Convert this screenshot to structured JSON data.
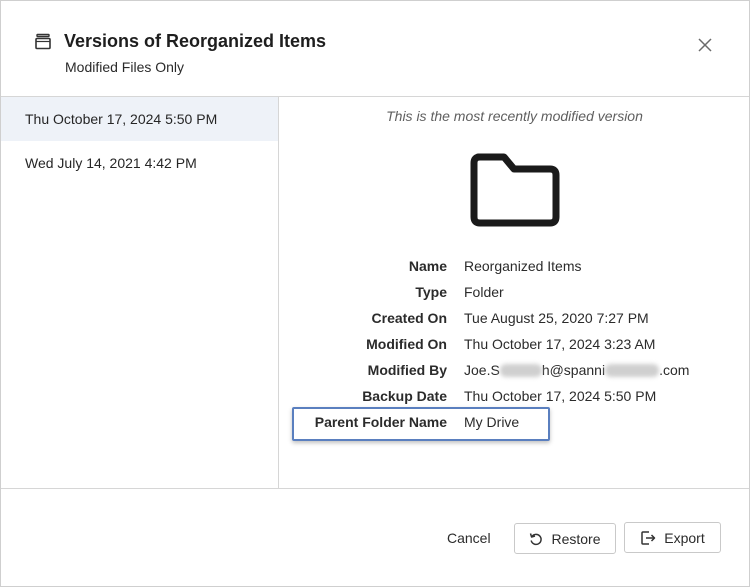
{
  "header": {
    "title": "Versions of Reorganized Items",
    "subtitle": "Modified Files Only",
    "title_icon": "archive-box-icon",
    "close_icon": "close-icon"
  },
  "versions": [
    {
      "label": "Thu October 17, 2024 5:50 PM",
      "selected": true
    },
    {
      "label": "Wed July 14, 2021 4:42 PM",
      "selected": false
    }
  ],
  "details": {
    "note": "This is the most recently modified version",
    "preview_icon": "folder-icon",
    "properties": {
      "name": {
        "label": "Name",
        "value": "Reorganized Items"
      },
      "type": {
        "label": "Type",
        "value": "Folder"
      },
      "created_on": {
        "label": "Created On",
        "value": "Tue August 25, 2020 7:27 PM"
      },
      "modified_on": {
        "label": "Modified On",
        "value": "Thu October 17, 2024 3:23 AM"
      },
      "modified_by": {
        "label": "Modified By",
        "value_parts": [
          "Joe.S",
          "h@spanni",
          ".com"
        ]
      },
      "backup_date": {
        "label": "Backup Date",
        "value": "Thu October 17, 2024 5:50 PM"
      },
      "parent_folder": {
        "label": "Parent Folder Name",
        "value": "My Drive"
      }
    }
  },
  "footer": {
    "cancel_label": "Cancel",
    "restore_label": "Restore",
    "export_label": "Export"
  },
  "colors": {
    "selected_row_bg": "#eef2f8",
    "highlight_border": "#5a7fbf",
    "divider": "#d6d6d6"
  }
}
